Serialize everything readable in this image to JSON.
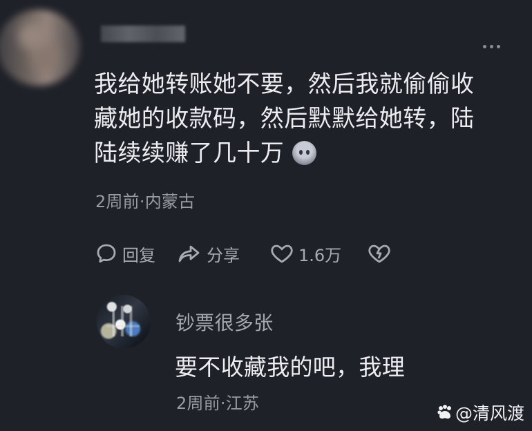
{
  "main_comment": {
    "text": "我给她转账她不要，然后我就偷偷收\n藏她的收款码，然后默默给她转，陆\n陆续续赚了几十万",
    "emoji_icon": "face-emoji-icon",
    "meta": "2周前·内蒙古",
    "actions": {
      "reply_label": "回复",
      "share_label": "分享",
      "like_count": "1.6万"
    }
  },
  "reply": {
    "username": "钞票很多张",
    "text": "要不收藏我的吧，我理",
    "meta": "2周前·江苏"
  },
  "watermark": {
    "text": "@清风渡",
    "icon": "paw-icon"
  }
}
